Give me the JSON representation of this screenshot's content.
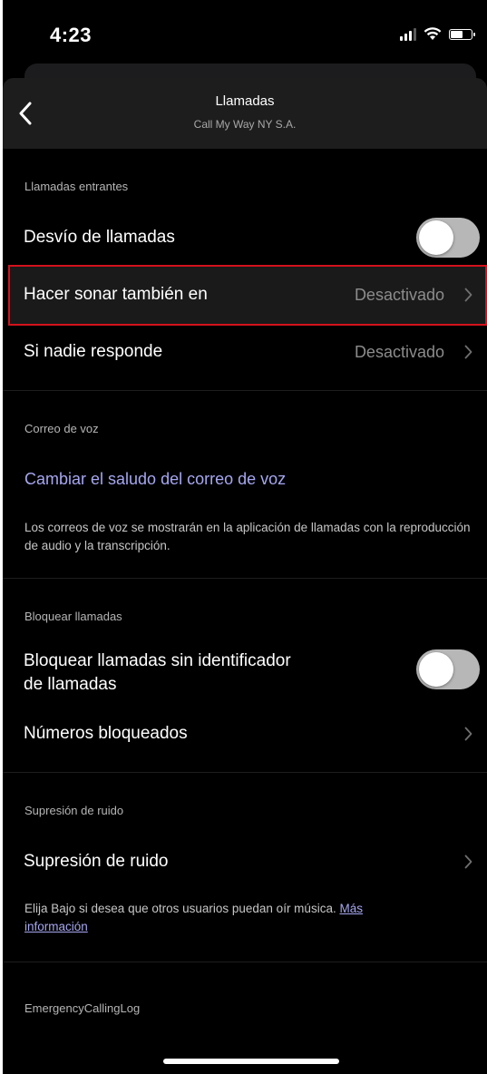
{
  "status_bar": {
    "time": "4:23",
    "signal_icon": "cellular-signal-icon",
    "wifi_icon": "wifi-icon",
    "battery_icon": "battery-icon"
  },
  "header": {
    "title": "Llamadas",
    "subtitle": "Call My Way NY S.A.",
    "back_icon": "chevron-left-icon"
  },
  "sections": {
    "incoming": {
      "label": "Llamadas entrantes",
      "forwarding_label": "Desvío de llamadas",
      "forwarding_enabled": false,
      "also_ring_label": "Hacer sonar también en",
      "also_ring_value": "Desactivado",
      "no_answer_label": "Si nadie responde",
      "no_answer_value": "Desactivado"
    },
    "voicemail": {
      "label": "Correo de voz",
      "change_greeting_link": "Cambiar el saludo del correo de voz",
      "description": "Los correos de voz se mostrarán en la aplicación de llamadas con la reproducción de audio y la transcripción."
    },
    "block": {
      "label": "Bloquear llamadas",
      "block_anonymous_label_line1": "Bloquear llamadas sin identificador",
      "block_anonymous_label_line2": "de llamadas",
      "block_anonymous_enabled": false,
      "blocked_numbers_label": "Números bloqueados"
    },
    "noise": {
      "label": "Supresión de ruido",
      "noise_suppression_label": "Supresión de ruido",
      "description": "Elija Bajo si desea que otros usuarios puedan oír música. ",
      "more_info_link_line1": "Más",
      "more_info_link_line2": "información"
    },
    "emergency": {
      "label": "EmergencyCallingLog"
    }
  },
  "colors": {
    "background": "#000000",
    "header_bg": "#1d1d1d",
    "link": "#a6a7f0",
    "highlight_border": "#d3121c",
    "toggle_off": "#b7b7b7"
  }
}
